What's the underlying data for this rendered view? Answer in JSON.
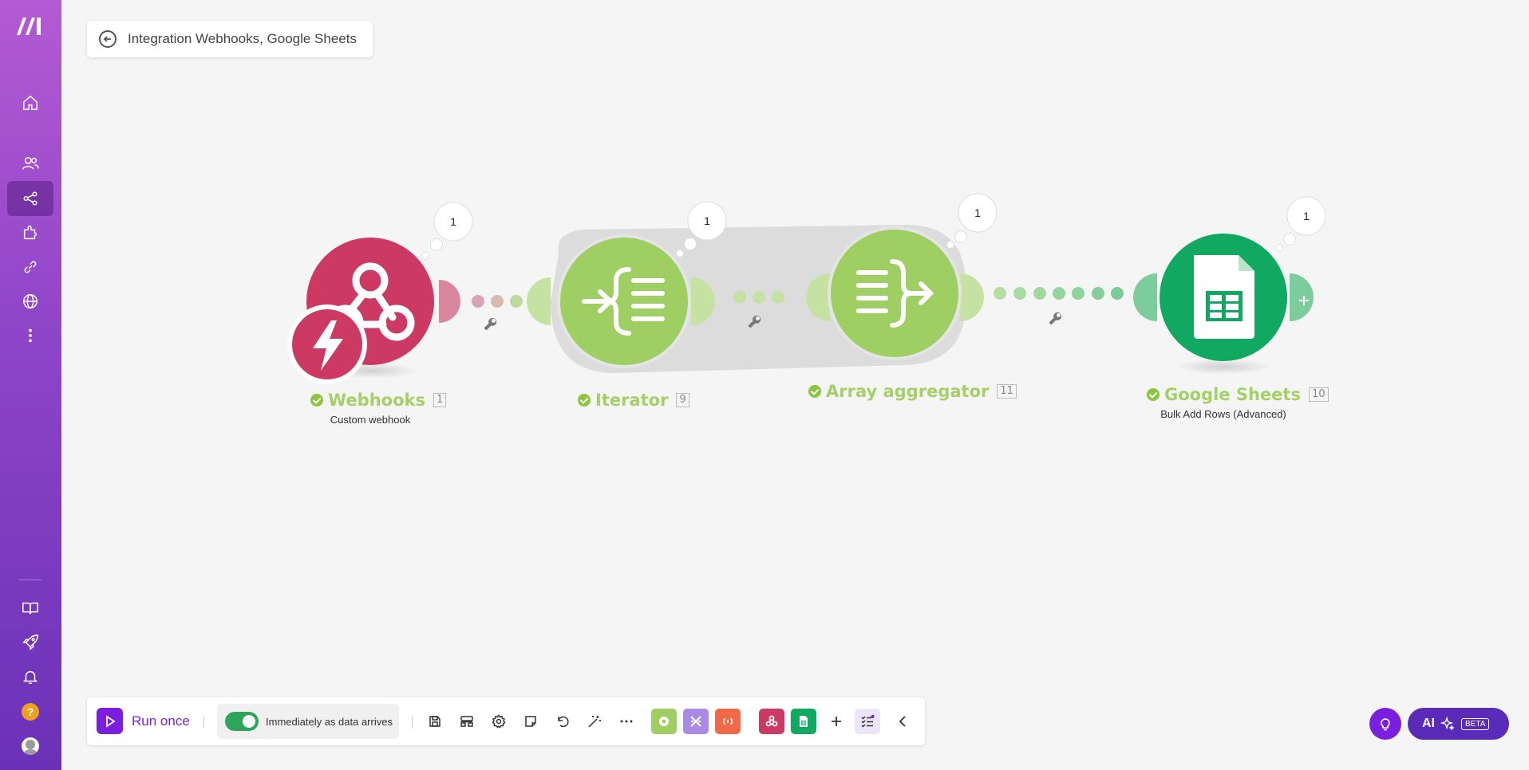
{
  "app": {
    "title": "Integration Webhooks, Google Sheets"
  },
  "sidebar": {
    "items": [
      {
        "name": "home-icon"
      },
      {
        "name": "team-icon"
      },
      {
        "name": "scenarios-icon"
      },
      {
        "name": "apps-icon"
      },
      {
        "name": "connections-icon"
      },
      {
        "name": "webhooks-globe-icon"
      },
      {
        "name": "more-icon"
      },
      {
        "name": "docs-book-icon"
      },
      {
        "name": "rocket-icon"
      },
      {
        "name": "bell-icon"
      },
      {
        "name": "help-icon"
      },
      {
        "name": "avatar"
      }
    ],
    "help_label": "?"
  },
  "modules": [
    {
      "name": "Webhooks",
      "id": "1",
      "subtitle": "Custom webhook",
      "bubble": "1",
      "color": "#cc3a63"
    },
    {
      "name": "Iterator",
      "id": "9",
      "subtitle": "",
      "bubble": "1",
      "color": "#9fcf62"
    },
    {
      "name": "Array aggregator",
      "id": "11",
      "subtitle": "",
      "bubble": "1",
      "color": "#9fcf62"
    },
    {
      "name": "Google Sheets",
      "id": "10",
      "subtitle": "Bulk Add Rows (Advanced)",
      "bubble": "1",
      "color": "#11a861"
    }
  ],
  "toolbar": {
    "run_label": "Run once",
    "schedule_label": "Immediately as data arrives",
    "schedule_on": true,
    "icons": [
      "save-icon",
      "auto-align-icon",
      "settings-icon",
      "notes-icon",
      "undo-icon",
      "magic-wand-icon",
      "more-dots-icon"
    ],
    "tiles": [
      {
        "name": "tools-tile",
        "color": "#9fcf62"
      },
      {
        "name": "flow-control-tile",
        "color": "#a98be6"
      },
      {
        "name": "text-parser-tile",
        "color": "#f06a4a"
      },
      {
        "name": "webhooks-tile",
        "color": "#cc3a63"
      },
      {
        "name": "google-sheets-tile",
        "color": "#11a861"
      }
    ]
  },
  "ai": {
    "label": "AI",
    "badge": "BETA"
  }
}
